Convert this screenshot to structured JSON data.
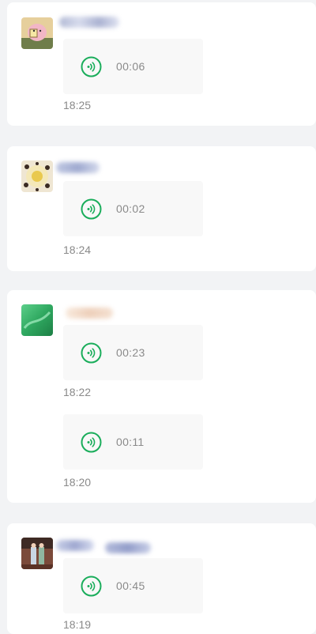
{
  "colors": {
    "background": "#f2f3f5",
    "card": "#ffffff",
    "bubble": "#f8f8f8",
    "accent_green": "#1aad5b",
    "meta_text": "#8a8a8a"
  },
  "icons": {
    "voice_play": "voice-wave-icon"
  },
  "posts": [
    {
      "messages": [
        {
          "duration": "00:06",
          "time": "18:25"
        }
      ]
    },
    {
      "messages": [
        {
          "duration": "00:02",
          "time": "18:24"
        }
      ]
    },
    {
      "messages": [
        {
          "duration": "00:23",
          "time": "18:22"
        },
        {
          "duration": "00:11",
          "time": "18:20"
        }
      ]
    },
    {
      "messages": [
        {
          "duration": "00:45",
          "time": "18:19"
        }
      ]
    }
  ]
}
